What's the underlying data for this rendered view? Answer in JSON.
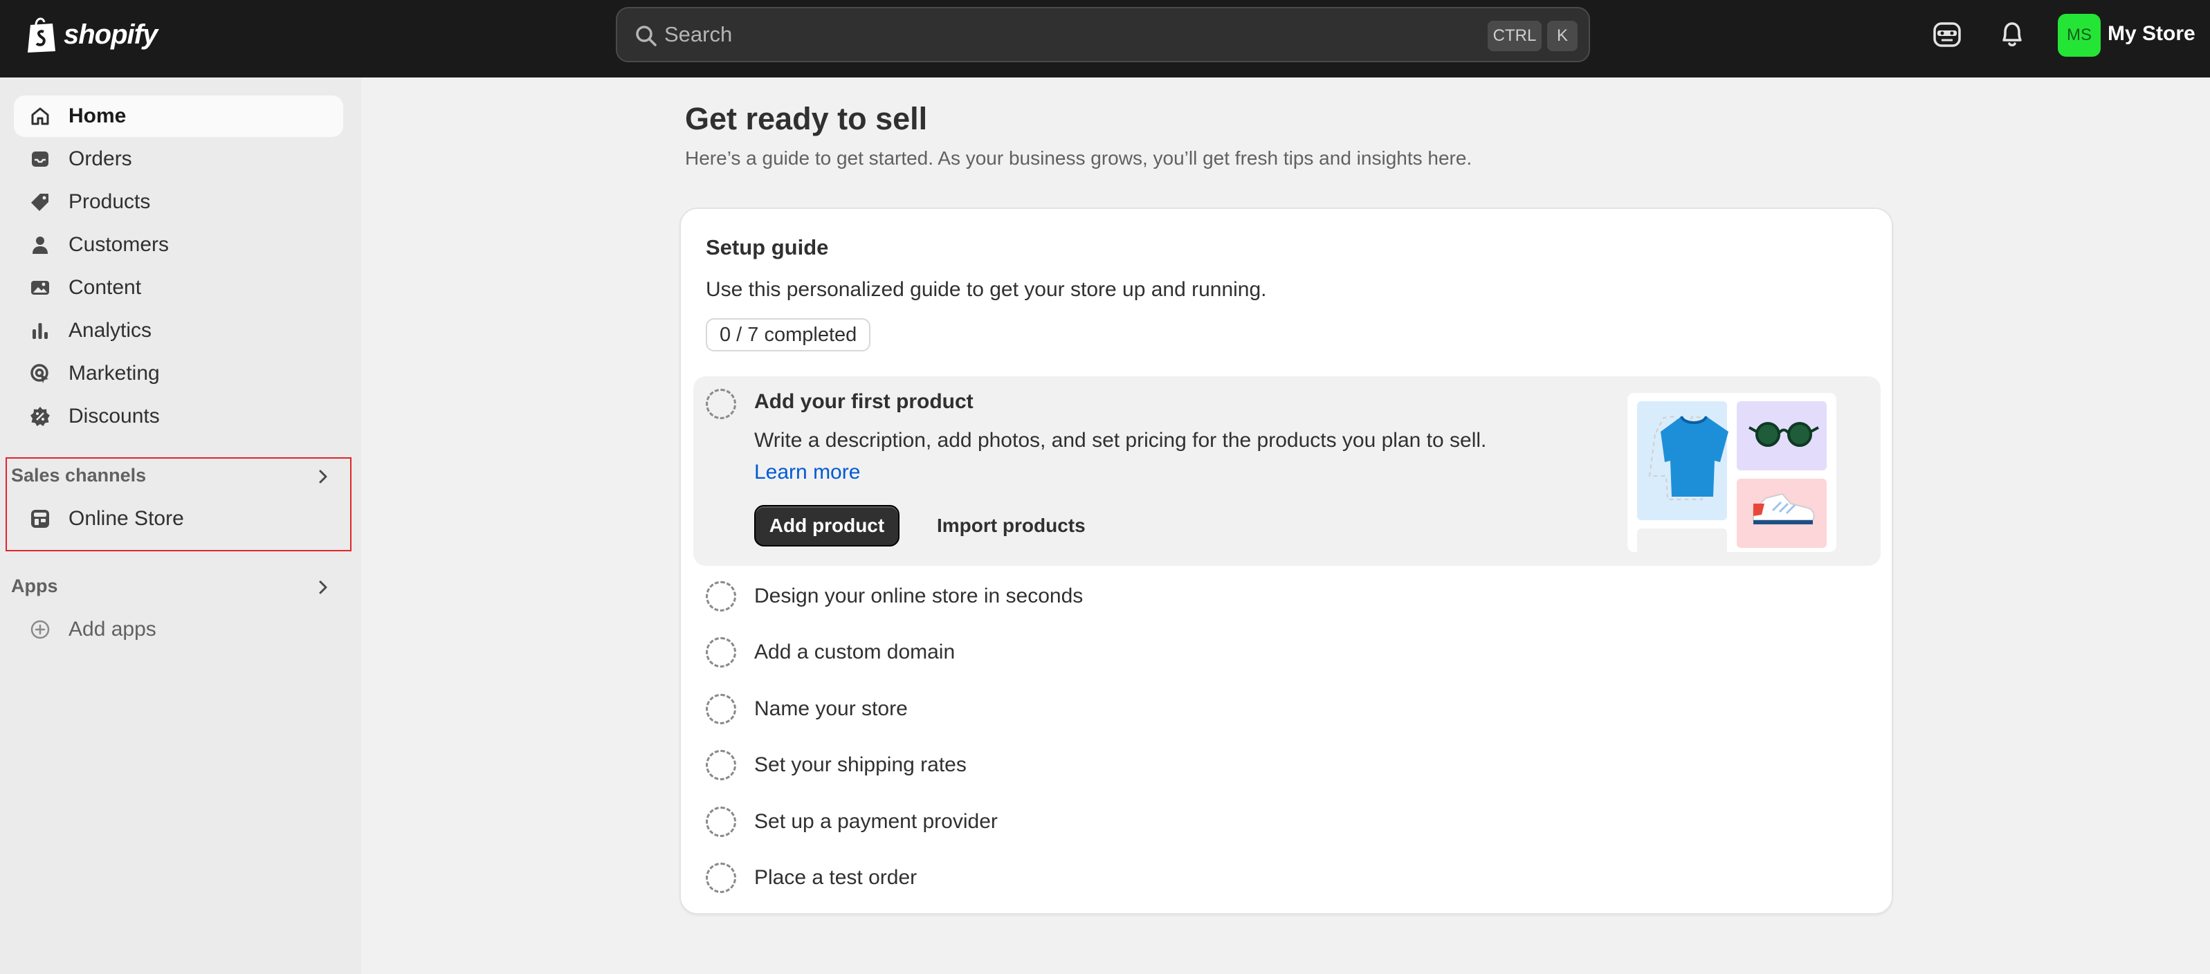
{
  "topbar": {
    "brand": "shopify",
    "search_placeholder": "Search",
    "shortcut_ctrl": "CTRL",
    "shortcut_k": "K",
    "avatar_initials": "MS",
    "store_name": "My Store",
    "colors": {
      "bar": "#1a1a1a",
      "avatar": "#24e536"
    }
  },
  "sidebar": {
    "items": [
      {
        "label": "Home",
        "icon": "home-icon",
        "active": true
      },
      {
        "label": "Orders",
        "icon": "inbox-icon"
      },
      {
        "label": "Products",
        "icon": "tag-icon"
      },
      {
        "label": "Customers",
        "icon": "person-icon"
      },
      {
        "label": "Content",
        "icon": "image-icon"
      },
      {
        "label": "Analytics",
        "icon": "bar-chart-icon"
      },
      {
        "label": "Marketing",
        "icon": "target-icon"
      },
      {
        "label": "Discounts",
        "icon": "discount-icon"
      }
    ],
    "sales_channels": {
      "heading": "Sales channels",
      "items": [
        {
          "label": "Online Store",
          "icon": "store-icon"
        }
      ]
    },
    "apps": {
      "heading": "Apps",
      "items": [
        {
          "label": "Add apps",
          "icon": "plus-circle-icon"
        }
      ]
    }
  },
  "main": {
    "title": "Get ready to sell",
    "subtitle": "Here’s a guide to get started. As your business grows, you’ll get fresh tips and insights here.",
    "setup_guide": {
      "title": "Setup guide",
      "description": "Use this personalized guide to get your store up and running.",
      "progress": "0 / 7 completed",
      "active_task": {
        "title": "Add your first product",
        "description": "Write a description, add photos, and set pricing for the products you plan to sell.",
        "link": "Learn more",
        "primary_button": "Add product",
        "secondary_button": "Import products"
      },
      "tasks": [
        "Design your online store in seconds",
        "Add a custom domain",
        "Name your store",
        "Set your shipping rates",
        "Set up a payment provider",
        "Place a test order"
      ]
    }
  }
}
